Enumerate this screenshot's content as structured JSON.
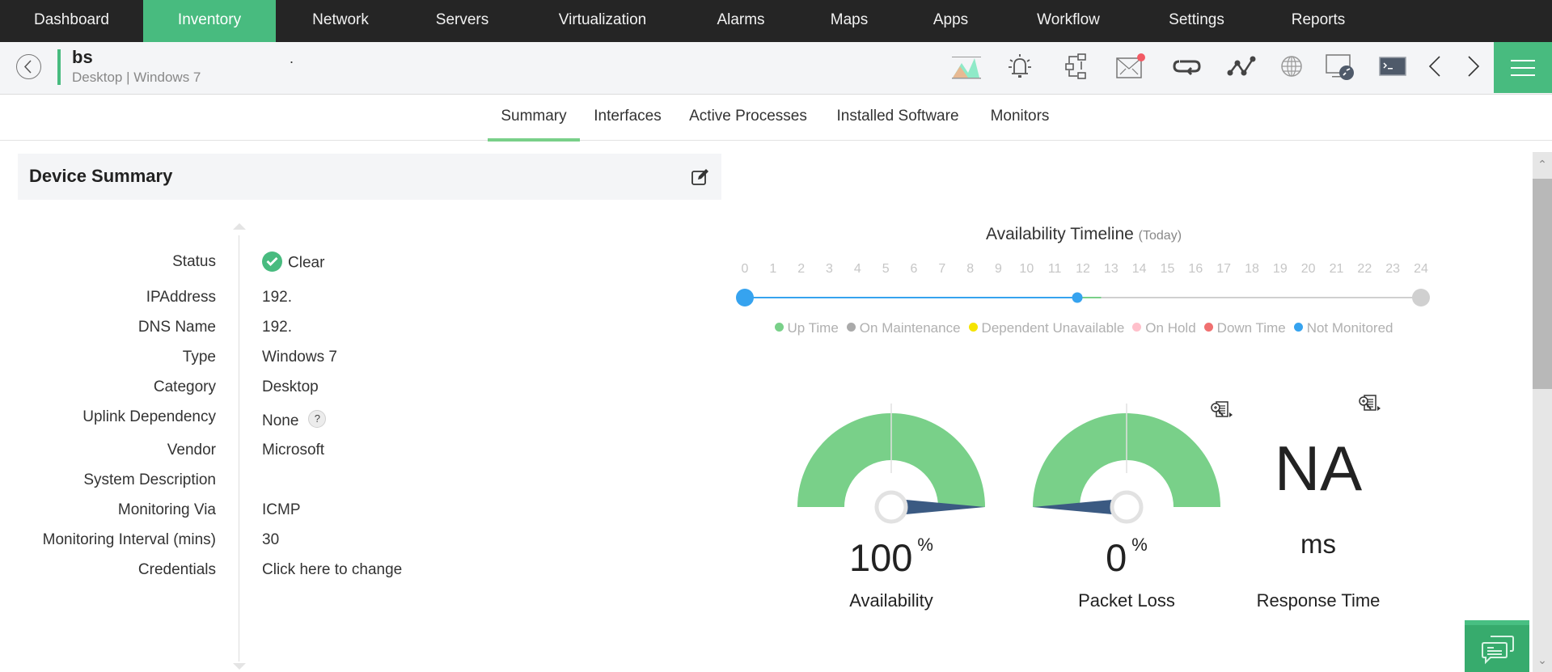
{
  "topnav": {
    "items": [
      {
        "label": "Dashboard"
      },
      {
        "label": "Inventory",
        "active": true
      },
      {
        "label": "Network"
      },
      {
        "label": "Servers"
      },
      {
        "label": "Virtualization"
      },
      {
        "label": "Alarms"
      },
      {
        "label": "Maps"
      },
      {
        "label": "Apps"
      },
      {
        "label": "Workflow"
      },
      {
        "label": "Settings"
      },
      {
        "label": "Reports"
      }
    ]
  },
  "device": {
    "name": "bs",
    "subtitle": "Desktop | Windows 7",
    "mark": "."
  },
  "toolbar_icons": [
    "graph-icon",
    "alarm-bell-icon",
    "workflow-icon",
    "mail-icon",
    "sync-icon",
    "path-icon",
    "globe-icon",
    "remote-desktop-icon",
    "terminal-icon",
    "previous-icon",
    "next-icon",
    "menu-icon"
  ],
  "tabs": [
    {
      "label": "Summary",
      "active": true
    },
    {
      "label": "Interfaces"
    },
    {
      "label": "Active Processes"
    },
    {
      "label": "Installed Software"
    },
    {
      "label": "Monitors"
    }
  ],
  "summary": {
    "title": "Device Summary",
    "rows": [
      {
        "label": "Status",
        "value": "Clear"
      },
      {
        "label": "IPAddress",
        "value": "192."
      },
      {
        "label": "DNS Name",
        "value": "192."
      },
      {
        "label": "Type",
        "value": "Windows 7"
      },
      {
        "label": "Category",
        "value": "Desktop"
      },
      {
        "label": "Uplink Dependency",
        "value": "None"
      },
      {
        "label": "Vendor",
        "value": "Microsoft"
      },
      {
        "label": "System Description",
        "value": ""
      },
      {
        "label": "Monitoring Via",
        "value": "ICMP"
      },
      {
        "label": "Monitoring Interval (mins)",
        "value": "30"
      },
      {
        "label": "Credentials",
        "value": "Click here to change"
      }
    ],
    "help_glyph": "?"
  },
  "timeline": {
    "title": "Availability Timeline",
    "subtitle": "(Today)",
    "hours": [
      "0",
      "1",
      "2",
      "3",
      "4",
      "5",
      "6",
      "7",
      "8",
      "9",
      "10",
      "11",
      "12",
      "13",
      "14",
      "15",
      "16",
      "17",
      "18",
      "19",
      "20",
      "21",
      "22",
      "23",
      "24"
    ],
    "segments": [
      {
        "from": 0,
        "to": 11.8,
        "state": "Not Monitored"
      },
      {
        "from": 11.8,
        "to": 12.65,
        "state": "Up Time"
      },
      {
        "from": 12.65,
        "to": 24,
        "state": "Future"
      }
    ],
    "current_hour": 11.8,
    "legend": [
      {
        "label": "Up Time",
        "color": "#79d089"
      },
      {
        "label": "On Maintenance",
        "color": "#aaaaaa"
      },
      {
        "label": "Dependent Unavailable",
        "color": "#f5e400"
      },
      {
        "label": "On Hold",
        "color": "#ffc0cb"
      },
      {
        "label": "Down Time",
        "color": "#f07070"
      },
      {
        "label": "Not Monitored",
        "color": "#36a3ef"
      }
    ]
  },
  "metrics": {
    "availability": {
      "value": "100",
      "unit": "%",
      "label": "Availability",
      "fraction": 1.0
    },
    "packet_loss": {
      "value": "0",
      "unit": "%",
      "label": "Packet Loss",
      "fraction": 0.0
    },
    "response_time": {
      "value": "NA",
      "unit": "ms",
      "label": "Response Time"
    }
  },
  "colors": {
    "accent": "#48bb7f",
    "gauge_fill": "#79d089",
    "needle": "#3b5a82",
    "nav_bg": "#252525",
    "not_monitored": "#36a3ef"
  }
}
